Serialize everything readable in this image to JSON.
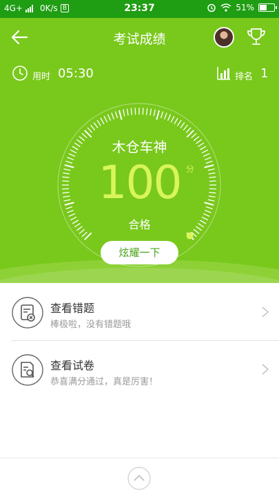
{
  "status_bar": {
    "network": "4G+",
    "speed": "0K/s",
    "badge": "B",
    "time": "23:37",
    "battery": "51%",
    "battery_level": 0.51
  },
  "header": {
    "title": "考试成绩"
  },
  "info": {
    "time_label": "用时",
    "time_value": "05:30",
    "rank_label": "排名",
    "rank_value": "1"
  },
  "result": {
    "player": "木仓车神",
    "score": "100",
    "score_unit": "分",
    "status": "合格",
    "score_fraction": 1.0,
    "share_button": "炫耀一下"
  },
  "list": [
    {
      "title": "查看错题",
      "subtitle": "棒极啦，没有错题哦",
      "icon": "wrong-questions-icon"
    },
    {
      "title": "查看试卷",
      "subtitle": "恭喜满分通过，真是厉害！",
      "icon": "exam-paper-icon"
    }
  ],
  "colors": {
    "primary_green": "#79c81c",
    "status_green": "#1f9d13",
    "score_color": "#d8f55b"
  }
}
